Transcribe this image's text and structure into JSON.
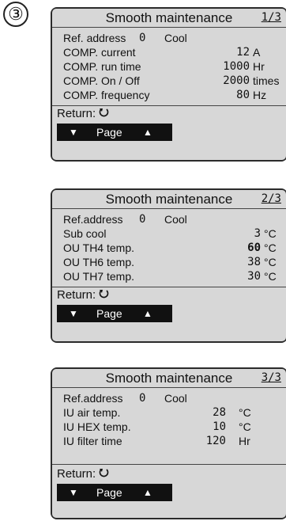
{
  "step_label": "③",
  "screens": [
    {
      "title": "Smooth maintenance",
      "page": "1/3",
      "ref_label": "Ref. address",
      "ref_value": "0",
      "mode": "Cool",
      "rows": [
        {
          "label": "COMP. current",
          "value": "12",
          "unit": "A"
        },
        {
          "label": "COMP. run time",
          "value": "1000",
          "unit": "Hr"
        },
        {
          "label": "COMP. On / Off",
          "value": "2000",
          "unit": "times"
        },
        {
          "label": "COMP. frequency",
          "value": "80",
          "unit": "Hz"
        }
      ],
      "return_label": "Return:",
      "return_icon": "return-icon",
      "page_button": {
        "down_icon": "▼",
        "label": "Page",
        "up_icon": "▲"
      }
    },
    {
      "title": "Smooth maintenance",
      "page": "2/3",
      "ref_label": "Ref.address",
      "ref_value": "0",
      "mode": "Cool",
      "rows": [
        {
          "label": "Sub cool",
          "value": "3",
          "unit": "°C"
        },
        {
          "label": "OU TH4 temp.",
          "value": "60",
          "unit": "°C"
        },
        {
          "label": "OU TH6 temp.",
          "value": "38",
          "unit": "°C"
        },
        {
          "label": "OU TH7 temp.",
          "value": "30",
          "unit": "°C"
        }
      ],
      "return_label": "Return:",
      "return_icon": "return-icon",
      "page_button": {
        "down_icon": "▼",
        "label": "Page",
        "up_icon": "▲"
      }
    },
    {
      "title": "Smooth maintenance",
      "page": "3/3",
      "ref_label": "Ref.address",
      "ref_value": "0",
      "mode": "Cool",
      "rows": [
        {
          "label": "IU air temp.",
          "value": "28",
          "unit": "°C"
        },
        {
          "label": "IU HEX temp.",
          "value": "10",
          "unit": "°C"
        },
        {
          "label": "IU filter time",
          "value": "120",
          "unit": "Hr"
        }
      ],
      "return_label": "Return:",
      "return_icon": "return-icon",
      "page_button": {
        "down_icon": "▼",
        "label": "Page",
        "up_icon": "▲"
      }
    }
  ]
}
